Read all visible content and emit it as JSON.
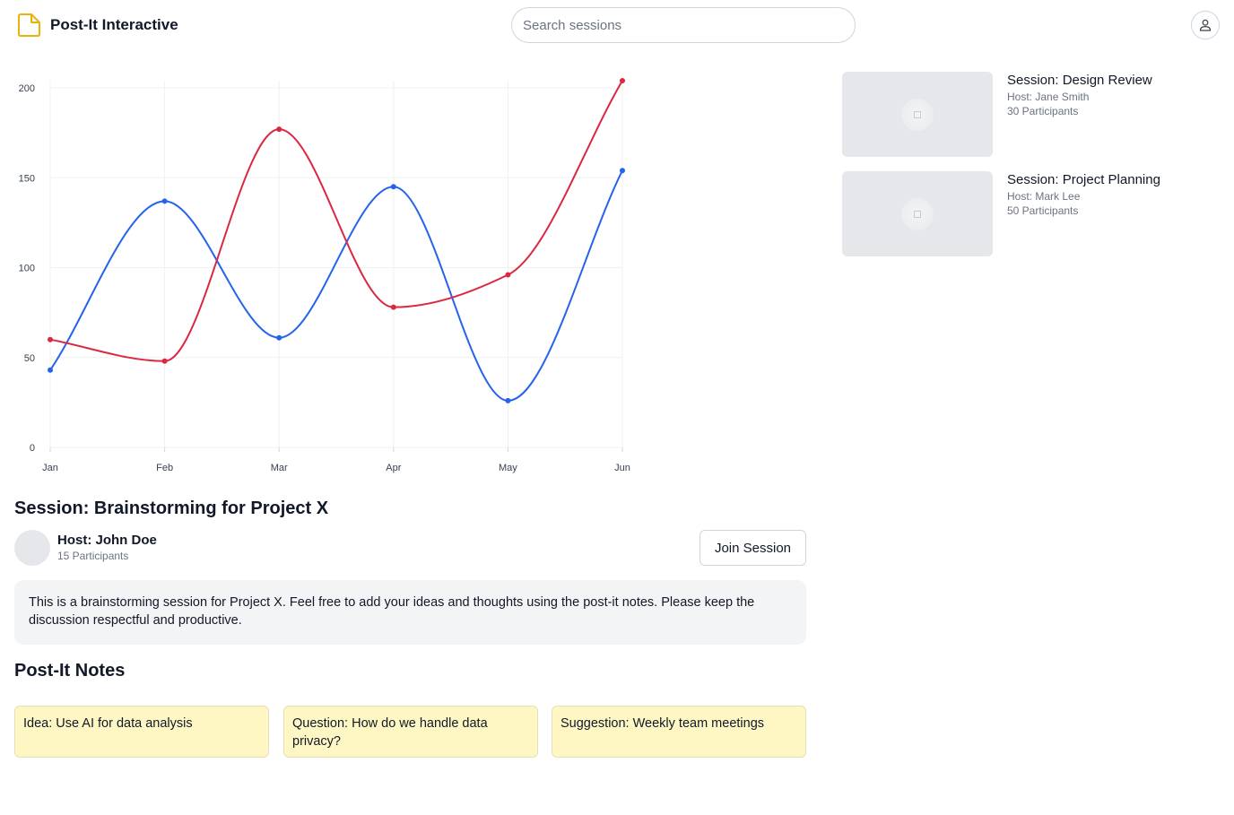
{
  "header": {
    "app_title": "Post-It Interactive",
    "search_placeholder": "Search sessions",
    "logo_icon": "sticky-note-icon",
    "user_icon": "user-icon",
    "logo_color": "#eab308"
  },
  "chart_data": {
    "type": "line",
    "categories": [
      "Jan",
      "Feb",
      "Mar",
      "Apr",
      "May",
      "Jun"
    ],
    "series": [
      {
        "color": "#2563eb",
        "values": [
          43,
          137,
          61,
          145,
          26,
          154
        ]
      },
      {
        "color": "#dc2743",
        "values": [
          60,
          48,
          177,
          78,
          96,
          204
        ]
      }
    ],
    "ylim": [
      0,
      200
    ],
    "yticks": [
      0,
      50,
      100,
      150,
      200
    ],
    "grid": true,
    "curve": "smooth"
  },
  "session": {
    "title": "Session: Brainstorming for Project X",
    "host": "Host: John Doe",
    "participants": "15 Participants",
    "join_label": "Join Session",
    "description": "This is a brainstorming session for Project X. Feel free to add your ideas and thoughts using the post-it notes. Please keep the discussion respectful and productive."
  },
  "notes": {
    "heading": "Post-It Notes",
    "items": [
      "Idea: Use AI for data analysis",
      "Question: How do we handle data privacy?",
      "Suggestion: Weekly team meetings"
    ],
    "color": "#fef7c3"
  },
  "related_sessions": [
    {
      "title": "Session: Design Review",
      "host": "Host: Jane Smith",
      "participants": "30 Participants"
    },
    {
      "title": "Session: Project Planning",
      "host": "Host: Mark Lee",
      "participants": "50 Participants"
    }
  ]
}
